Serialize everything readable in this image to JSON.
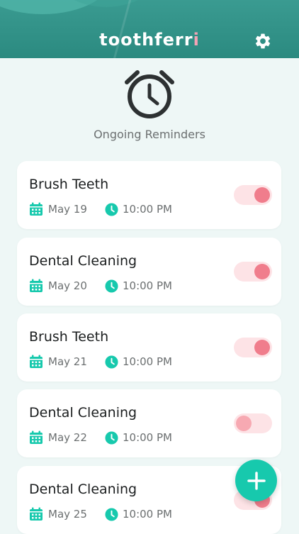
{
  "app": {
    "name_main": "toothferr",
    "name_accent": "i"
  },
  "header": {
    "settings_icon": "gear-icon",
    "section_icon": "alarm-clock-icon",
    "section_title": "Ongoing Reminders"
  },
  "colors": {
    "header": "#2f8f85",
    "accent": "#17c9ad",
    "logo_accent": "#f4a3b5",
    "toggle_track": "#fde3e6",
    "toggle_knob": "#f07d8c"
  },
  "reminders": [
    {
      "title": "Brush Teeth",
      "date": "May 19",
      "time": "10:00 PM",
      "enabled": true
    },
    {
      "title": "Dental Cleaning",
      "date": "May 20",
      "time": "10:00 PM",
      "enabled": true
    },
    {
      "title": "Brush Teeth",
      "date": "May 21",
      "time": "10:00 PM",
      "enabled": true
    },
    {
      "title": "Dental Cleaning",
      "date": "May 22",
      "time": "10:00 PM",
      "enabled": false
    },
    {
      "title": "Dental Cleaning",
      "date": "May 25",
      "time": "10:00 PM",
      "enabled": true
    }
  ],
  "fab": {
    "icon": "plus-icon",
    "action": "add reminder"
  }
}
